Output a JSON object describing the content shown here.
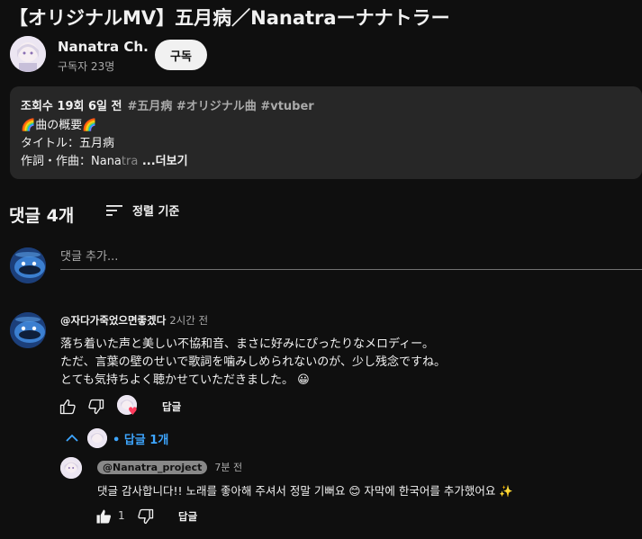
{
  "video": {
    "title": "【オリジナルMV】五月病／Nanatraーナナトラー"
  },
  "channel": {
    "name": "Nanatra Ch.",
    "subscribers": "구독자 23명",
    "subscribe_label": "구독"
  },
  "description": {
    "meta": "조회수 19회  6일 전",
    "tags": "#五月病 #オリジナル曲 #vtuber",
    "line2": "曲の概要",
    "line3": "タイトル：五月病",
    "line4_main": "作詞・作曲：Nana",
    "line4_fade": "tra",
    "more_label": " ...더보기",
    "emoji_left": "🌈",
    "emoji_right": "🌈"
  },
  "comments_header": {
    "count": "댓글 4개",
    "sort_label": "정렬 기준"
  },
  "add_comment": {
    "placeholder": "댓글 추가..."
  },
  "comment": {
    "author": "@자다가죽었으면좋겠다",
    "time": "2시간 전",
    "lines": [
      "落ち着いた声と美しい不協和音、まさに好みにぴったりなメロディー。",
      "ただ、言葉の壁のせいで歌詞を噛みしめられないのが、少し残念ですね。",
      "とても気持ちよく聴かせていただきました。"
    ],
    "emoji": "😀",
    "reply_label": "답글",
    "heart": "♥"
  },
  "replies": {
    "toggle_label": "• 답글 1개"
  },
  "reply": {
    "author": "@Nanatra_project",
    "time": "7분 전",
    "text_a": "댓글 감사합니다!! 노래를 좋아해 주셔서 정말 기뻐요",
    "emoji_a": "😊",
    "text_b": "자막에 한국어를 추가했어요",
    "emoji_b": "✨",
    "like_count": "1",
    "reply_label": "답글"
  },
  "colors": {
    "background": "#0f0f0f",
    "panel": "#272727",
    "link": "#3ea6ff"
  }
}
